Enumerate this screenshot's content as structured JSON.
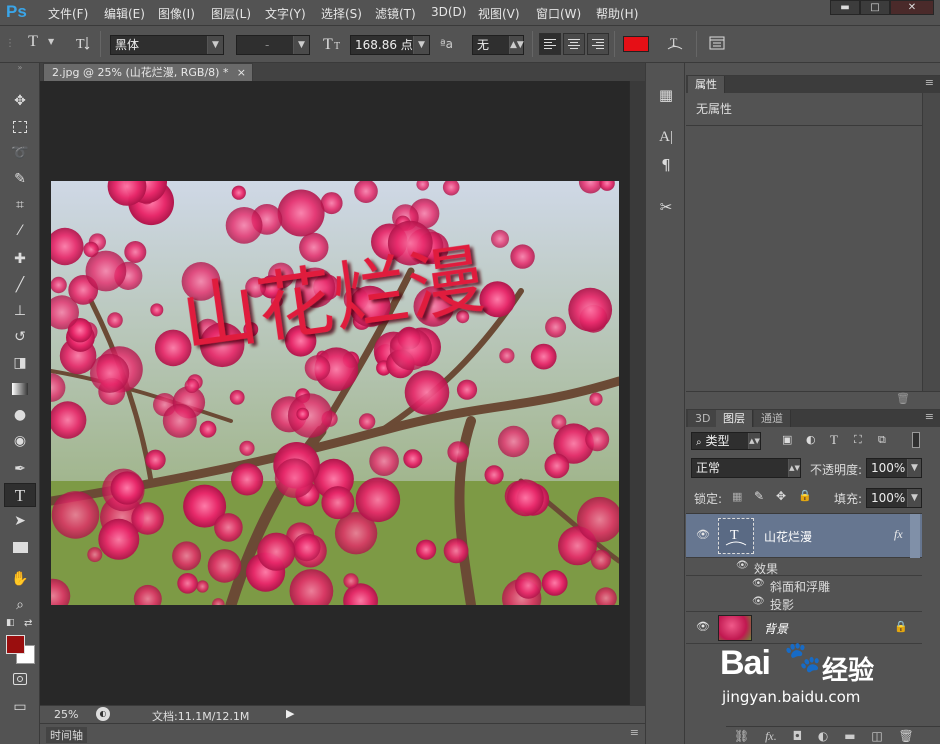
{
  "app": {
    "logo": "Ps"
  },
  "menu": [
    "文件(F)",
    "编辑(E)",
    "图像(I)",
    "图层(L)",
    "文字(Y)",
    "选择(S)",
    "滤镜(T)",
    "3D(D)",
    "视图(V)",
    "窗口(W)",
    "帮助(H)"
  ],
  "window_controls": {
    "minimize": "▬",
    "maximize": "□",
    "close": "✕"
  },
  "options": {
    "tool_glyph": "T",
    "font_family": "黑体",
    "font_style": "-",
    "font_size": "168.86 点",
    "aa_label": "ªa",
    "antialias": "无",
    "text_color": "#e60f16"
  },
  "document": {
    "tab_title": "2.jpg @ 25% (山花烂漫, RGB/8) *",
    "tab_close": "×",
    "text_overlay": "山花烂漫",
    "text_color": "#e01a3c"
  },
  "status": {
    "zoom": "25%",
    "doc_info": "文档:11.1M/12.1M"
  },
  "timeline": {
    "label": "时间轴"
  },
  "properties": {
    "tab": "属性",
    "content": "无属性"
  },
  "layers_panel": {
    "tabs": [
      "3D",
      "图层",
      "通道"
    ],
    "filter_kind": "类型",
    "blend_mode": "正常",
    "opacity_label": "不透明度:",
    "opacity": "100%",
    "lock_label": "锁定:",
    "fill_label": "填充:",
    "fill": "100%",
    "layers": [
      {
        "name": "山花烂漫",
        "type": "text",
        "fx": "fx",
        "effects_label": "效果",
        "effects": [
          "斜面和浮雕",
          "投影"
        ]
      },
      {
        "name": "背景",
        "type": "image",
        "locked": true
      }
    ]
  },
  "watermark": {
    "brand": "Bai",
    "brand2": "经验",
    "url": "jingyan.baidu.com"
  }
}
